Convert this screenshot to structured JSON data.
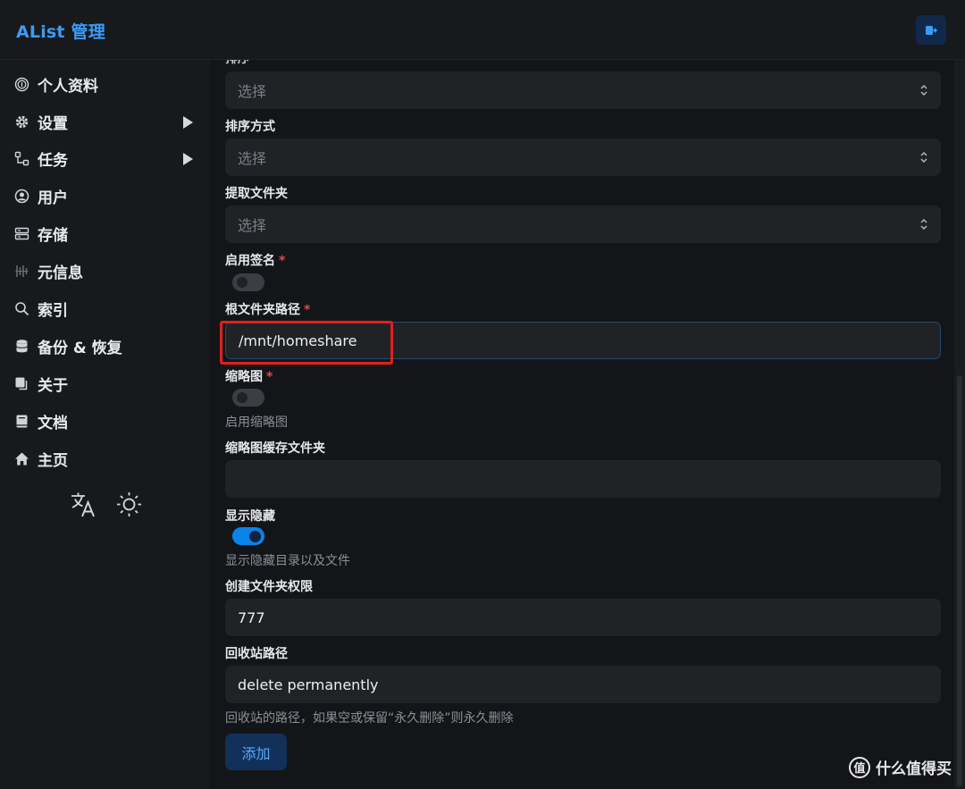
{
  "app": {
    "title": "AList 管理"
  },
  "sidebar": {
    "items": [
      {
        "label": "个人资料",
        "icon": "fingerprint-icon",
        "has_arrow": false
      },
      {
        "label": "设置",
        "icon": "gear-icon",
        "has_arrow": true
      },
      {
        "label": "任务",
        "icon": "flow-icon",
        "has_arrow": true
      },
      {
        "label": "用户",
        "icon": "user-circle-icon",
        "has_arrow": false
      },
      {
        "label": "存储",
        "icon": "storage-icon",
        "has_arrow": false
      },
      {
        "label": "元信息",
        "icon": "meta-icon",
        "has_arrow": false
      },
      {
        "label": "索引",
        "icon": "search-icon",
        "has_arrow": false
      },
      {
        "label": "备份 & 恢复",
        "icon": "database-icon",
        "has_arrow": false
      },
      {
        "label": "关于",
        "icon": "copy-icon",
        "has_arrow": false
      },
      {
        "label": "文档",
        "icon": "book-icon",
        "has_arrow": false
      },
      {
        "label": "主页",
        "icon": "home-icon",
        "has_arrow": false
      }
    ]
  },
  "form": {
    "top_partial_label": "排序",
    "order_select": {
      "placeholder": "选择"
    },
    "order_direction": {
      "label": "排序方式",
      "placeholder": "选择"
    },
    "extract_folder": {
      "label": "提取文件夹",
      "placeholder": "选择"
    },
    "enable_sign": {
      "label": "启用签名",
      "required": "*",
      "on": false
    },
    "root_folder": {
      "label": "根文件夹路径",
      "required": "*",
      "value": "/mnt/homeshare"
    },
    "thumbnail": {
      "label": "缩略图",
      "required": "*",
      "on": false,
      "help": "启用缩略图"
    },
    "thumb_cache": {
      "label": "缩略图缓存文件夹",
      "value": ""
    },
    "show_hidden": {
      "label": "显示隐藏",
      "on": true,
      "help": "显示隐藏目录以及文件"
    },
    "mkdir_perm": {
      "label": "创建文件夹权限",
      "value": "777"
    },
    "recycle_bin": {
      "label": "回收站路径",
      "value": "delete permanently",
      "help": "回收站的路径，如果空或保留“永久删除”则永久删除"
    },
    "add_button": "添加"
  },
  "watermark": {
    "logo": "值",
    "text": "什么值得买"
  },
  "colors": {
    "accent": "#3b9cf6",
    "highlight": "#e0201d",
    "toggle_on": "#0a84e8"
  }
}
